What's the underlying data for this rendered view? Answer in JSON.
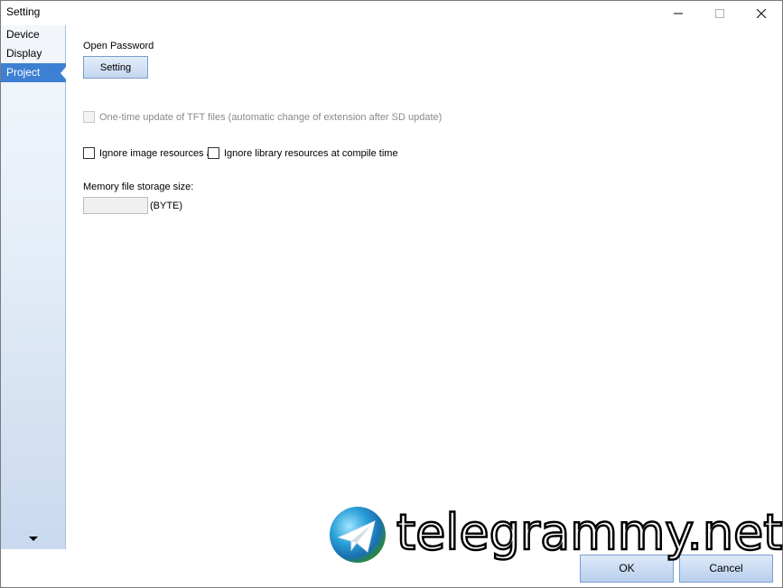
{
  "window": {
    "title": "Setting"
  },
  "sidebar": {
    "items": [
      {
        "label": "Device",
        "active": false
      },
      {
        "label": "Display",
        "active": false
      },
      {
        "label": "Project",
        "active": true
      }
    ]
  },
  "content": {
    "open_password_label": "Open Password",
    "setting_button_label": "Setting",
    "one_time_update_label": "One-time update of TFT files (automatic change of extension after SD update)",
    "one_time_update_checked": false,
    "one_time_update_enabled": false,
    "ignore_image_label": "Ignore image resources a",
    "ignore_image_checked": false,
    "ignore_library_label": "Ignore library resources at compile time",
    "ignore_library_checked": false,
    "memory_size_label": "Memory file storage size:",
    "memory_size_value": "",
    "memory_size_unit": "(BYTE)"
  },
  "footer": {
    "ok_label": "OK",
    "cancel_label": "Cancel"
  },
  "watermark": {
    "text": "telegrammy.net"
  }
}
